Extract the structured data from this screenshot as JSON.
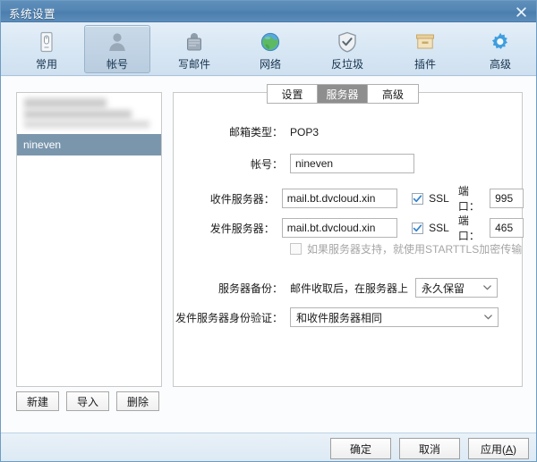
{
  "window": {
    "title": "系统设置",
    "close_label": "✕"
  },
  "toolbar": {
    "items": [
      {
        "label": "常用",
        "icon": "general-icon",
        "selected": false
      },
      {
        "label": "帐号",
        "icon": "user-icon",
        "selected": true
      },
      {
        "label": "写邮件",
        "icon": "compose-mail-icon",
        "selected": false
      },
      {
        "label": "网络",
        "icon": "globe-network-icon",
        "selected": false
      },
      {
        "label": "反垃圾",
        "icon": "shield-check-icon",
        "selected": false
      },
      {
        "label": "插件",
        "icon": "plugin-box-icon",
        "selected": false
      },
      {
        "label": "高级",
        "icon": "gear-icon",
        "selected": false
      }
    ]
  },
  "account_list": {
    "items": [
      {
        "label": "",
        "blurred": true,
        "selected": false
      },
      {
        "label": "nineven",
        "blurred": false,
        "selected": true
      }
    ],
    "buttons": [
      {
        "label": "新建",
        "name": "new-account-button"
      },
      {
        "label": "导入",
        "name": "import-account-button"
      },
      {
        "label": "删除",
        "name": "delete-account-button"
      }
    ]
  },
  "tabs": [
    {
      "label": "设置",
      "active": false
    },
    {
      "label": "服务器",
      "active": true
    },
    {
      "label": "高级",
      "active": false
    }
  ],
  "form": {
    "mail_type_label": "邮箱类型：",
    "mail_type_value": "POP3",
    "account_label": "帐号：",
    "account_value": "nineven",
    "incoming_label": "收件服务器：",
    "incoming_value": "mail.bt.dvcloud.xin",
    "incoming_ssl_label": "SSL",
    "incoming_ssl_checked": true,
    "incoming_port_label": "端口：",
    "incoming_port_value": "995",
    "outgoing_label": "发件服务器：",
    "outgoing_value": "mail.bt.dvcloud.xin",
    "outgoing_ssl_label": "SSL",
    "outgoing_ssl_checked": true,
    "outgoing_port_label": "端口：",
    "outgoing_port_value": "465",
    "starttls_label": "如果服务器支持，就使用STARTTLS加密传输",
    "starttls_checked": false,
    "backup_label": "服务器备份：",
    "backup_prefix": "邮件收取后，在服务器上",
    "backup_value": "永久保留",
    "auth_label": "发件服务器身份验证：",
    "auth_value": "和收件服务器相同",
    "chevron": "⌄"
  },
  "footer": {
    "buttons": [
      {
        "label": "确定",
        "name": "ok-button",
        "underline_char": ""
      },
      {
        "label": "取消",
        "name": "cancel-button",
        "underline_char": ""
      },
      {
        "label": "应用(A)",
        "name": "apply-button",
        "underline_char": "A"
      }
    ]
  },
  "colors": {
    "titlebar": "#5486b4",
    "toolbar_top": "#e4eef8",
    "selection": "#7a96ad",
    "tab_active": "#8e8e8e",
    "accent_check": "#2f7fd0"
  }
}
